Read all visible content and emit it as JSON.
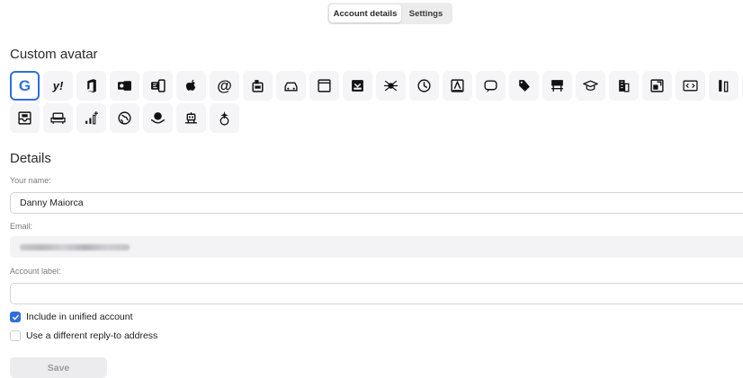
{
  "tabs": [
    {
      "label": "Account details",
      "active": true
    },
    {
      "label": "Settings",
      "active": false
    }
  ],
  "custom_avatar": {
    "title": "Custom avatar",
    "row1": [
      "google-icon",
      "yahoo-icon",
      "office-icon",
      "outlook-icon",
      "exchange-icon",
      "apple-icon",
      "at-sign-icon",
      "mailbox-icon",
      "car-icon",
      "calendar-icon",
      "inbox-download-icon",
      "spider-icon",
      "history-icon",
      "id-badge-icon",
      "chat-bubble-icon",
      "price-tag-icon",
      "classroom-icon",
      "graduation-cap-icon",
      "office-building-icon",
      "share-icon",
      "code-window-icon",
      "tools-icon",
      "coffee-cup-icon"
    ],
    "row2": [
      "mail-tray-icon",
      "sofa-icon",
      "growth-chart-icon",
      "globe-icon",
      "earth-hands-icon",
      "robot-icon",
      "sparkle-icon"
    ],
    "selected": "google-icon",
    "accent": "#2f6fdc",
    "google_text": "G",
    "yahoo_text": "y!",
    "at_text": "@"
  },
  "details": {
    "title": "Details",
    "name_label": "Your name:",
    "name_value": "Danny Maiorca",
    "email_label": "Email:",
    "account_label_label": "Account label:",
    "account_label_value": "",
    "unified_label": "Include in unified account",
    "unified_checked": true,
    "reply_to_label": "Use a different reply-to address",
    "reply_to_checked": false,
    "save_label": "Save"
  }
}
